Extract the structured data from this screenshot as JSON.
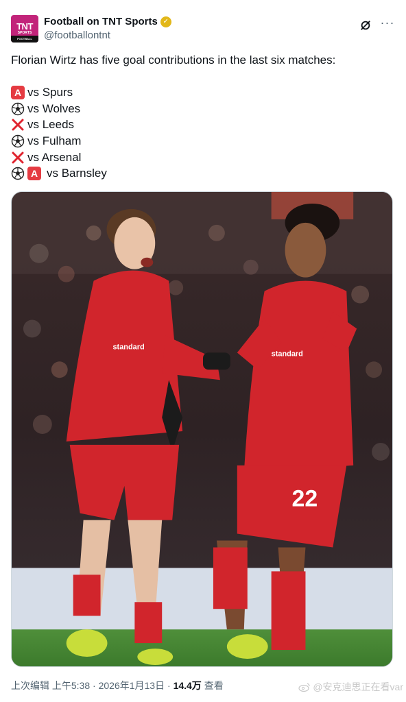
{
  "account": {
    "display_name": "Football on TNT Sports",
    "handle": "@footballontnt",
    "avatar_text_top": "TNT",
    "avatar_text_mid": "SPORTS",
    "avatar_text_bottom": "FOOTBALL",
    "verified_color": "#e2b719"
  },
  "tweet": {
    "text": "Florian Wirtz has five goal contributions in the last six matches:",
    "list": [
      {
        "icons": [
          "assist"
        ],
        "label": "vs Spurs"
      },
      {
        "icons": [
          "goal"
        ],
        "label": "vs Wolves"
      },
      {
        "icons": [
          "cross"
        ],
        "label": "vs Leeds"
      },
      {
        "icons": [
          "goal"
        ],
        "label": "vs Fulham"
      },
      {
        "icons": [
          "cross"
        ],
        "label": "vs Arsenal"
      },
      {
        "icons": [
          "goal",
          "assist"
        ],
        "label": "vs Barnsley"
      }
    ],
    "assist_glyph": "A"
  },
  "meta": {
    "edited": "上次编辑",
    "time": "上午5:38",
    "sep": "·",
    "date": "2026年1月13日",
    "views": "14.4万",
    "views_label": "查看"
  },
  "watermark": {
    "text": "@安克迪思正在看var"
  },
  "photo": {
    "description_icon": "photo-image",
    "jersey_text": "standard chartered",
    "number": "22"
  }
}
